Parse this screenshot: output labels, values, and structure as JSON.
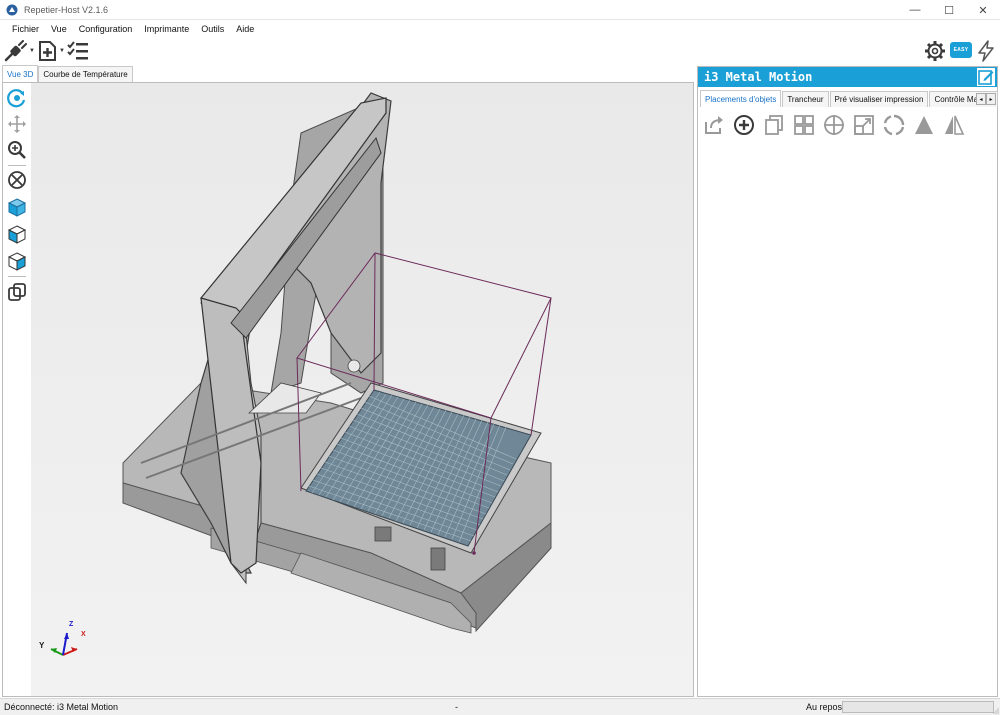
{
  "window": {
    "title": "Repetier-Host V2.1.6",
    "controls": {
      "minimize": "—",
      "maximize": "☐",
      "close": "✕"
    }
  },
  "menu": [
    "Fichier",
    "Vue",
    "Configuration",
    "Imprimante",
    "Outils",
    "Aide"
  ],
  "toolbar": {
    "left": [
      "connect-icon",
      "add-object-icon",
      "print-queue-icon"
    ],
    "right": [
      "settings-gear-icon",
      "easy-mode-badge",
      "lightning-icon"
    ],
    "easy_label": "EASY"
  },
  "view_tabs": [
    "Vue 3D",
    "Courbe de Température"
  ],
  "view_tools": [
    "rotate-view-icon",
    "move-view-icon",
    "zoom-view-icon",
    "fit-view-icon",
    "iso-view-icon",
    "front-view-icon",
    "top-view-icon",
    "parallel-view-icon"
  ],
  "axes": {
    "x": "X",
    "y": "Y",
    "z": "Z"
  },
  "printer_panel": {
    "name": "i3 Metal Motion",
    "tabs": [
      "Placements d'objets",
      "Trancheur",
      "Pré visualiser impression",
      "Contrôle Manuel"
    ],
    "tools": [
      "export-icon",
      "add-object-icon",
      "copy-icon",
      "arrange-icon",
      "center-icon",
      "scale-icon",
      "rotate-icon",
      "cut-icon",
      "mirror-icon"
    ]
  },
  "status": {
    "connection": "Déconnecté: i3 Metal Motion",
    "middle": "-",
    "state": "Au repos"
  },
  "colors": {
    "accent": "#1a9fd6",
    "tab_active": "#1a73c9",
    "bed": "#6f8796",
    "frame": "#a8a8a8"
  }
}
